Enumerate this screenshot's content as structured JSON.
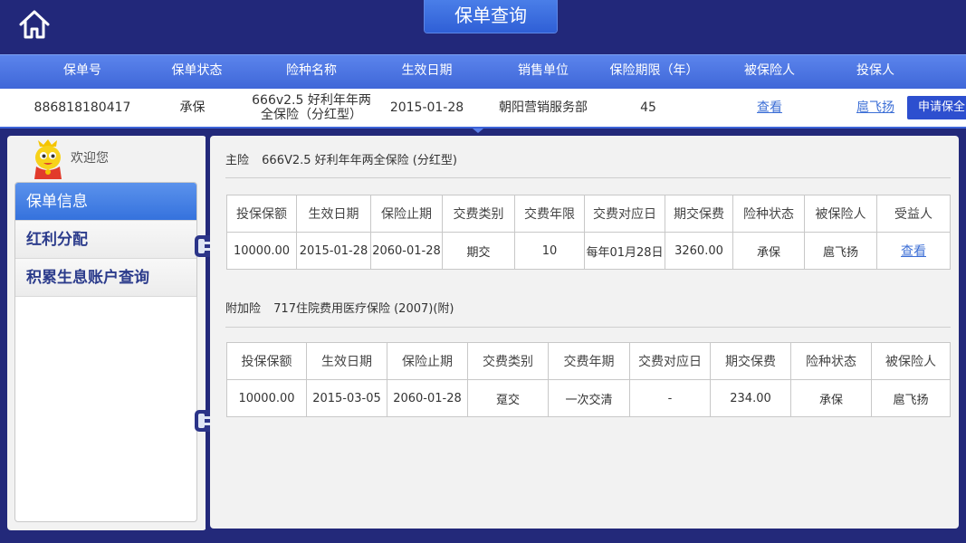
{
  "page": {
    "title": "保单查询"
  },
  "policy_header": {
    "columns": [
      "保单号",
      "保单状态",
      "险种名称",
      "生效日期",
      "销售单位",
      "保险期限（年）",
      "被保险人",
      "投保人"
    ]
  },
  "policy_row": {
    "policy_no": "886818180417",
    "status": "承保",
    "product_line1": "666v2.5 好利年年两",
    "product_line2": "全保险（分红型）",
    "effective_date": "2015-01-28",
    "sales_unit": "朝阳营销服务部",
    "term_years": "45",
    "insured_link": "查看",
    "applicant_link": "扈飞扬",
    "apply_button": "申请保全"
  },
  "sidebar": {
    "welcome": "欢迎您",
    "items": [
      {
        "label": "保单信息",
        "active": true
      },
      {
        "label": "红利分配",
        "active": false
      },
      {
        "label": "积累生息账户查询",
        "active": false
      }
    ]
  },
  "main_insurance": {
    "label": "主险",
    "name": "666V2.5 好利年年两全保险 (分红型)",
    "columns": [
      "投保保额",
      "生效日期",
      "保险止期",
      "交费类别",
      "交费年限",
      "交费对应日",
      "期交保费",
      "险种状态",
      "被保险人",
      "受益人"
    ],
    "row": [
      "10000.00",
      "2015-01-28",
      "2060-01-28",
      "期交",
      "10",
      "每年01月28日",
      "3260.00",
      "承保",
      "扈飞扬",
      "查看"
    ]
  },
  "rider_insurance": {
    "label": "附加险",
    "name": "717住院费用医疗保险 (2007)(附)",
    "columns": [
      "投保保额",
      "生效日期",
      "保险止期",
      "交费类别",
      "交费年期",
      "交费对应日",
      "期交保费",
      "险种状态",
      "被保险人"
    ],
    "row": [
      "10000.00",
      "2015-03-05",
      "2060-01-28",
      "趸交",
      "一次交清",
      "-",
      "234.00",
      "承保",
      "扈飞扬"
    ]
  },
  "colors": {
    "background": "#23297a",
    "header_blue": "#4a73e0",
    "link_blue": "#3d6fd6",
    "button_blue": "#2d4fcf"
  }
}
